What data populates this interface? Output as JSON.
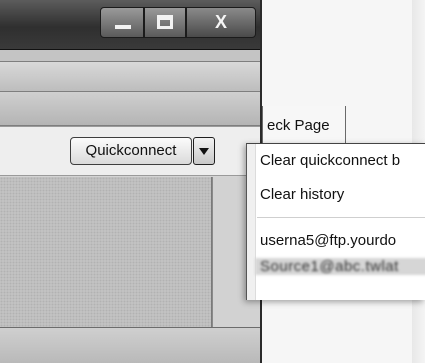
{
  "window": {
    "minimize_icon": "minimize-icon",
    "maximize_icon": "maximize-icon",
    "close_label": "X"
  },
  "toolbar": {
    "quickconnect_label": "Quickconnect",
    "dropdown_icon": "chevron-down-icon"
  },
  "tabs": {
    "check_page": "eck Page"
  },
  "quickconnect_menu": {
    "items": [
      {
        "label": "Clear quickconnect b"
      },
      {
        "label": "Clear history"
      },
      {
        "label": "userna5@ftp.yourdo"
      },
      {
        "label": "Source1@abc.twlat"
      }
    ]
  }
}
